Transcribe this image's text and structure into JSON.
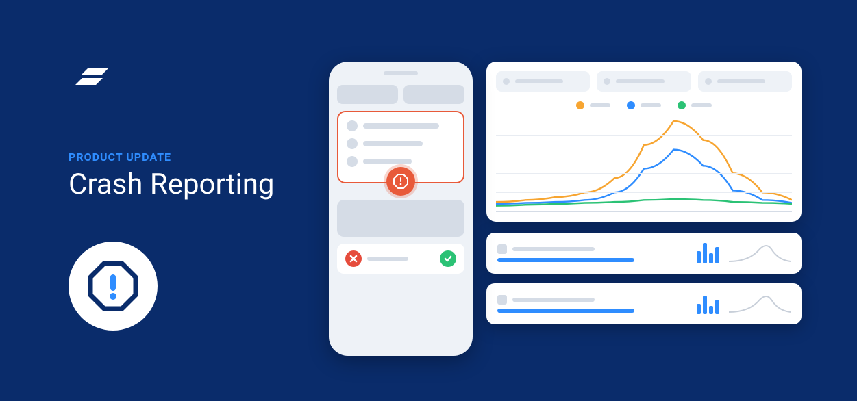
{
  "hero": {
    "eyebrow": "PRODUCT UPDATE",
    "title": "Crash Reporting"
  },
  "colors": {
    "orange": "#f7a531",
    "blue": "#2f8dff",
    "green": "#2bc275",
    "red": "#e85a3a",
    "navy": "#0a2c6b"
  },
  "chart_data": {
    "type": "line",
    "title": "",
    "xlabel": "",
    "ylabel": "",
    "x": [
      0,
      1,
      2,
      3,
      4,
      5,
      6,
      7,
      8,
      9,
      10
    ],
    "series": [
      {
        "name": "orange",
        "color": "#f7a531",
        "values": [
          10,
          12,
          15,
          20,
          35,
          70,
          95,
          75,
          40,
          20,
          12
        ]
      },
      {
        "name": "blue",
        "color": "#2f8dff",
        "values": [
          8,
          9,
          10,
          12,
          20,
          45,
          65,
          48,
          22,
          12,
          9
        ]
      },
      {
        "name": "green",
        "color": "#2bc275",
        "values": [
          6,
          7,
          8,
          9,
          10,
          12,
          13,
          12,
          10,
          9,
          8
        ]
      }
    ],
    "ylim": [
      0,
      100
    ]
  },
  "stat_panels": [
    {
      "bars": [
        0.6,
        1.0,
        0.5,
        0.8
      ],
      "colors": [
        "#2f8dff",
        "#2f8dff",
        "#2f8dff",
        "#2f8dff"
      ]
    },
    {
      "bars": [
        0.5,
        0.9,
        0.4,
        0.7
      ],
      "colors": [
        "#2f8dff",
        "#2f8dff",
        "#2f8dff",
        "#2f8dff"
      ]
    }
  ]
}
